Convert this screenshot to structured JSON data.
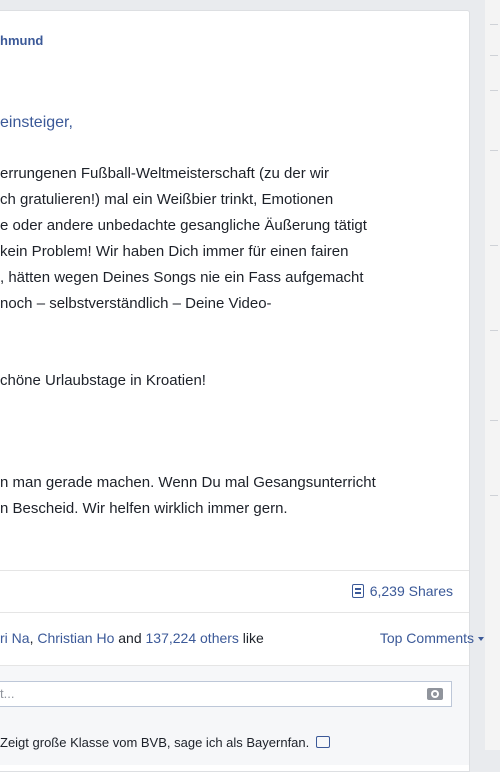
{
  "post": {
    "page_name": "hmund",
    "salutation": "einsteiger,",
    "paragraph1": [
      "errungenen Fußball-Weltmeisterschaft (zu der wir",
      "ch gratulieren!) mal ein Weißbier trinkt, Emotionen",
      "e oder andere unbedachte gesangliche Äußerung tätigt",
      "kein Problem! Wir haben Dich immer für einen fairen",
      ", hätten wegen Deines Songs nie ein Fass aufgemacht",
      "noch – selbstverständlich – Deine Video-"
    ],
    "paragraph2": "chöne Urlaubstage in Kroatien!",
    "paragraph3": [
      "n man gerade machen. Wenn Du mal Gesangsunterricht",
      "n Bescheid. Wir helfen wirklich immer gern."
    ]
  },
  "footer": {
    "shares_label": "6,239 Shares",
    "likes": {
      "name1": "ri Na",
      "sep": ", ",
      "name2": "Christian Ho",
      "and": " and ",
      "others": "137,224 others",
      "tail": " like"
    },
    "top_comments_label": "Top Comments"
  },
  "comment_box": {
    "placeholder": "t..."
  },
  "comment_preview": {
    "text": "Zeigt große Klasse vom BVB, sage ich als Bayernfan."
  },
  "colors": {
    "link": "#3b5998",
    "text": "#1d2129",
    "background": "#e9ebee"
  }
}
